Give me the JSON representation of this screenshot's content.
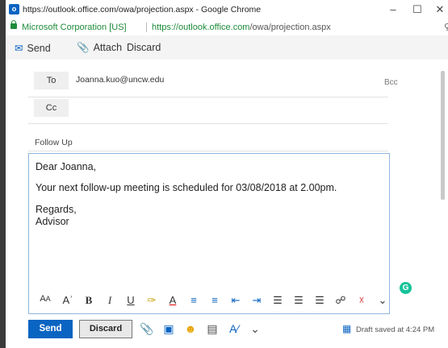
{
  "browser": {
    "title": "https://outlook.office.com/owa/projection.aspx - Google Chrome",
    "org": "Microsoft Corporation [US]",
    "url_host": "https://outlook.office.com",
    "url_path": "/owa/projection.aspx"
  },
  "toolbar": {
    "send_label": "Send",
    "attach_label": "Attach",
    "discard_label": "Discard"
  },
  "compose": {
    "to_label": "To",
    "to_value": "Joanna.kuo@uncw.edu",
    "bcc_label": "Bcc",
    "cc_label": "Cc",
    "subject": "Follow Up",
    "body_lines": [
      "Dear Joanna,",
      "Your next follow-up meeting is scheduled for 03/08/2018 at 2.00pm.",
      "Regards,",
      "Advisor"
    ]
  },
  "bottom": {
    "send_label": "Send",
    "discard_label": "Discard",
    "draft_status": "Draft saved at 4:24 PM"
  },
  "colors": {
    "accent": "#0a64c2",
    "secure_green": "#1e8c3a",
    "grammarly": "#15c39a"
  }
}
